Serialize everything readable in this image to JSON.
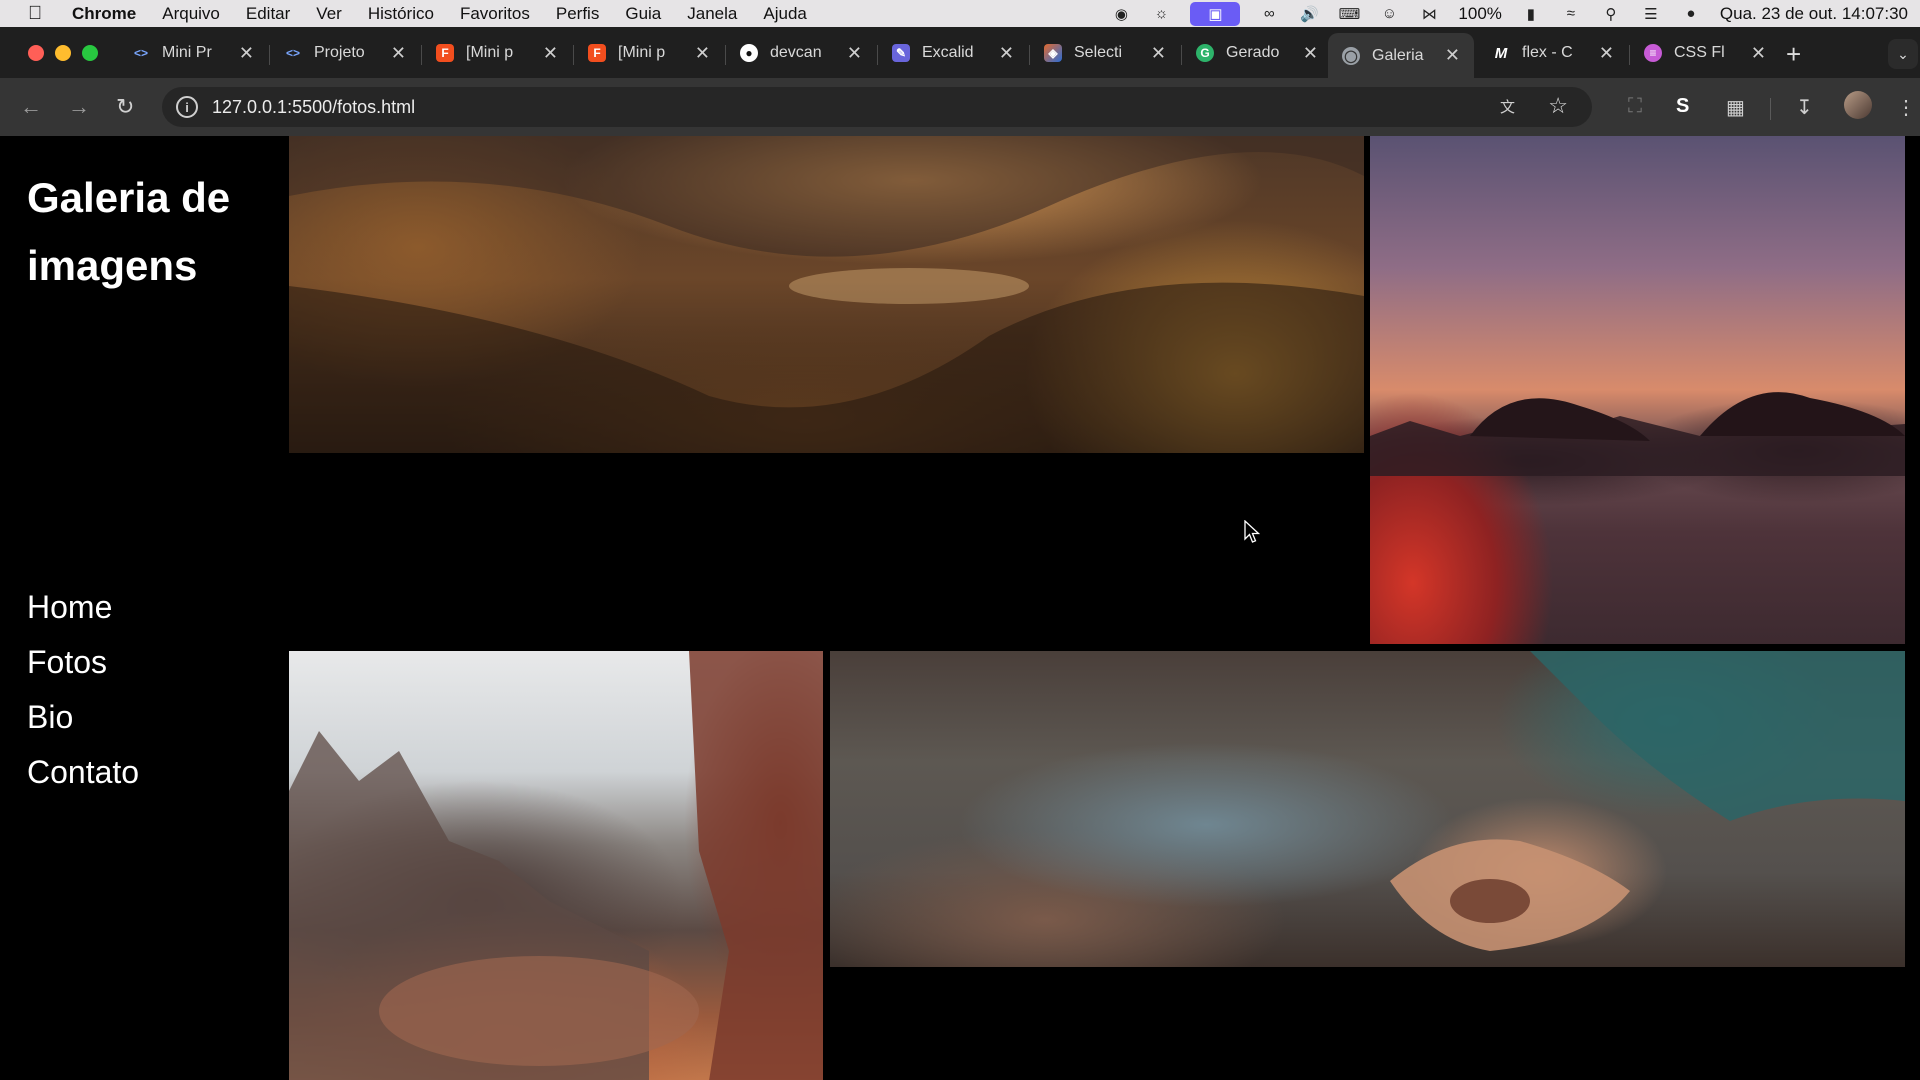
{
  "menubar": {
    "app": "Chrome",
    "items": [
      "Arquivo",
      "Editar",
      "Ver",
      "Histórico",
      "Favoritos",
      "Perfis",
      "Guia",
      "Janela",
      "Ajuda"
    ],
    "battery": "100%",
    "clock": "Qua. 23 de out.  14:07:30"
  },
  "tabs": [
    {
      "title": "Mini Pr",
      "favicon": "code-brackets-icon",
      "color": "#4a7bd6"
    },
    {
      "title": "Projeto",
      "favicon": "code-brackets-icon",
      "color": "#4a7bd6"
    },
    {
      "title": "[Mini p",
      "favicon": "figma-icon",
      "color": "#f24e1e"
    },
    {
      "title": "[Mini p",
      "favicon": "figma-icon",
      "color": "#f24e1e"
    },
    {
      "title": "devcan",
      "favicon": "github-icon",
      "color": "#ffffff"
    },
    {
      "title": "Excalid",
      "favicon": "excalidraw-icon",
      "color": "#6965db"
    },
    {
      "title": "Selecti",
      "favicon": "color-picker-icon",
      "color": "#e36a2e"
    },
    {
      "title": "Gerado",
      "favicon": "generator-icon",
      "color": "#2db36a"
    },
    {
      "title": "Galeria",
      "favicon": "globe-icon",
      "color": "#9aa0a6",
      "active": true
    },
    {
      "title": "flex - C",
      "favicon": "mdn-icon",
      "color": "#ffffff"
    },
    {
      "title": "CSS Fl",
      "favicon": "css-icon",
      "color": "#c75bd6"
    }
  ],
  "address_bar": {
    "url": "127.0.0.1:5500/fotos.html"
  },
  "page": {
    "title": "Galeria de imagens",
    "nav": [
      "Home",
      "Fotos",
      "Bio",
      "Contato"
    ]
  },
  "colors": {
    "page_background": "#000000",
    "text": "#ffffff",
    "chrome_toolbar": "#353535",
    "chrome_tabstrip": "#1f1f1f"
  }
}
